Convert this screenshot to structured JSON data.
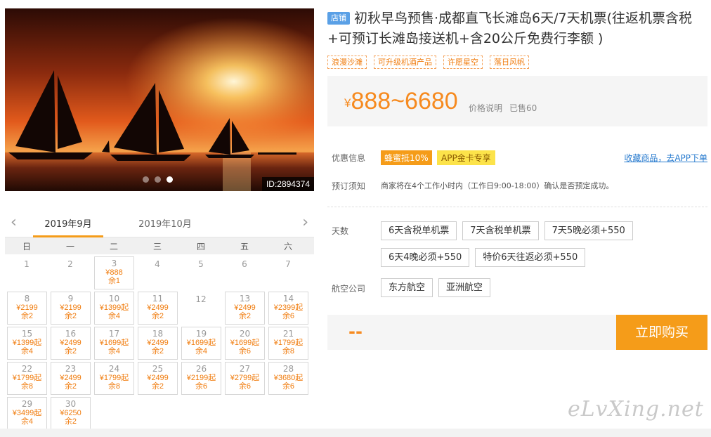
{
  "photo": {
    "id_label": "ID:2894374",
    "dots": 3,
    "active_dot": 2
  },
  "calendar": {
    "months": [
      "2019年9月",
      "2019年10月"
    ],
    "weekdays": [
      "日",
      "一",
      "二",
      "三",
      "四",
      "五",
      "六"
    ],
    "days": [
      {
        "d": "1"
      },
      {
        "d": "2"
      },
      {
        "d": "3",
        "p": "¥888",
        "r": "余1"
      },
      {
        "d": "4"
      },
      {
        "d": "5"
      },
      {
        "d": "6"
      },
      {
        "d": "7"
      },
      {
        "d": "8",
        "p": "¥2199",
        "r": "余2"
      },
      {
        "d": "9",
        "p": "¥2199",
        "r": "余2"
      },
      {
        "d": "10",
        "p": "¥1399起",
        "r": "余4"
      },
      {
        "d": "11",
        "p": "¥2499",
        "r": "余2"
      },
      {
        "d": "12"
      },
      {
        "d": "13",
        "p": "¥2499",
        "r": "余2"
      },
      {
        "d": "14",
        "p": "¥2399起",
        "r": "余6"
      },
      {
        "d": "15",
        "p": "¥1399起",
        "r": "余4"
      },
      {
        "d": "16",
        "p": "¥2499",
        "r": "余2"
      },
      {
        "d": "17",
        "p": "¥1699起",
        "r": "余4"
      },
      {
        "d": "18",
        "p": "¥2499",
        "r": "余2"
      },
      {
        "d": "19",
        "p": "¥1699起",
        "r": "余4"
      },
      {
        "d": "20",
        "p": "¥1699起",
        "r": "余6"
      },
      {
        "d": "21",
        "p": "¥1799起",
        "r": "余8"
      },
      {
        "d": "22",
        "p": "¥1799起",
        "r": "余8"
      },
      {
        "d": "23",
        "p": "¥2499",
        "r": "余2"
      },
      {
        "d": "24",
        "p": "¥1799起",
        "r": "余8"
      },
      {
        "d": "25",
        "p": "¥2499",
        "r": "余2"
      },
      {
        "d": "26",
        "p": "¥2199起",
        "r": "余6"
      },
      {
        "d": "27",
        "p": "¥2799起",
        "r": "余6"
      },
      {
        "d": "28",
        "p": "¥3680起",
        "r": "余6"
      },
      {
        "d": "29",
        "p": "¥3499起",
        "r": "余4"
      },
      {
        "d": "30",
        "p": "¥6250",
        "r": "余2"
      }
    ]
  },
  "product": {
    "shop_badge": "店铺",
    "title": "初秋早鸟预售·成都直飞长滩岛6天/7天机票(往返机票含税+可预订长滩岛接送机+含20公斤免费行李额 )",
    "tags": [
      "浪漫沙滩",
      "可升级机酒产品",
      "许愿星空",
      "落日风帆"
    ],
    "price": {
      "currency": "¥",
      "range": "888~6680",
      "note": "价格说明",
      "sold": "已售60"
    },
    "promo": {
      "label": "优惠信息",
      "badge1": "蜂蜜抵10%",
      "badge2": "APP金卡专享",
      "link": "收藏商品，去APP下单"
    },
    "notice": {
      "label": "预订须知",
      "text": "商家将在4个工作小时内（工作日9:00-18:00）确认是否预定成功。"
    },
    "days": {
      "label": "天数",
      "options": [
        "6天含税单机票",
        "7天含税单机票",
        "7天5晚必须+550",
        "6天4晚必须+550",
        "特价6天往返必须+550"
      ]
    },
    "airline": {
      "label": "航空公司",
      "options": [
        "东方航空",
        "亚洲航空"
      ]
    },
    "buy": {
      "placeholder_price": "--",
      "button": "立即购买"
    }
  },
  "watermark": "eLvXing.net",
  "colors": {
    "accent": "#f59c19",
    "price": "#f68a1f",
    "link": "#2a7ccf"
  }
}
